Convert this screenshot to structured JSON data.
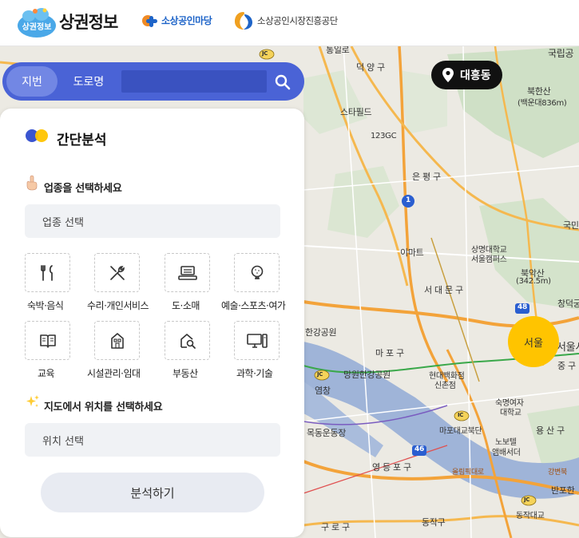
{
  "header": {
    "logo_badge": "상권정보",
    "site_title": "상권정보",
    "partner1": "소상공인마당",
    "partner2": "소상공인시장진흥공단"
  },
  "search": {
    "tab_jibun": "지번",
    "tab_road": "도로명",
    "placeholder": ""
  },
  "location": {
    "label": "대흥동"
  },
  "map": {
    "region_bubble": "서울",
    "labels": {
      "tongil": "통일로",
      "deokyang": "덕 양 구",
      "gukrip": "국립공",
      "bukhansan": "북한산",
      "baegundae": "(백운대836m)",
      "starfield": "스타필드",
      "gc123": "123GC",
      "eunpyeong": "은 평 구",
      "emart": "이마트",
      "sangmyung1": "상명대학교",
      "sangmyung2": "서울캠퍼스",
      "gukmin": "국민",
      "bugak1": "북악산",
      "bugak2": "(342.5m)",
      "seodaemun": "서 대 문 구",
      "changdeok": "창덕궁",
      "hangang_park": "한강공원",
      "mapo": "마 포 구",
      "mangwon": "망원한강공원",
      "hyundai1": "현대백화점",
      "hyundai2": "신촌점",
      "yeomchang": "염창",
      "seoulcity": "서울시청",
      "junggu": "중 구",
      "sookmyung1": "숙명여자",
      "sookmyung2": "대학교",
      "mapo_bridge_n": "마포대교북단",
      "yongsan": "용 산 구",
      "novotel1": "노보텔",
      "novotel2": "앰배서더",
      "mokdong": "목동운동장",
      "yeongdeungpo": "영 등 포 구",
      "olympic": "올림픽대로",
      "gangbyeon": "강변북",
      "banpo": "반포한",
      "guro": "구 로 구",
      "dongjak": "동작구",
      "dongjak_bridge": "동작대교",
      "jc": "JC",
      "ic": "IC",
      "route1": "1",
      "route46": "46",
      "route48": "48"
    }
  },
  "panel": {
    "title": "간단분석",
    "industry_section": "업종을 선택하세요",
    "industry_placeholder": "업종 선택",
    "location_section": "지도에서 위치를 선택하세요",
    "location_placeholder": "위치 선택",
    "analyze_button": "분석하기",
    "categories": [
      {
        "label": "숙박·음식",
        "icon": "fork-knife-icon"
      },
      {
        "label": "수리·개인서비스",
        "icon": "tools-icon"
      },
      {
        "label": "도·소매",
        "icon": "cash-register-icon"
      },
      {
        "label": "예술·스포츠·여가",
        "icon": "golf-icon"
      },
      {
        "label": "교육",
        "icon": "book-icon"
      },
      {
        "label": "시설관리·임대",
        "icon": "building-icon"
      },
      {
        "label": "부동산",
        "icon": "house-search-icon"
      },
      {
        "label": "과학·기술",
        "icon": "computer-icon"
      }
    ]
  },
  "colors": {
    "accent_blue": "#4a63d6",
    "seoul_yellow": "#ffc400",
    "river": "#9fb4d8"
  }
}
